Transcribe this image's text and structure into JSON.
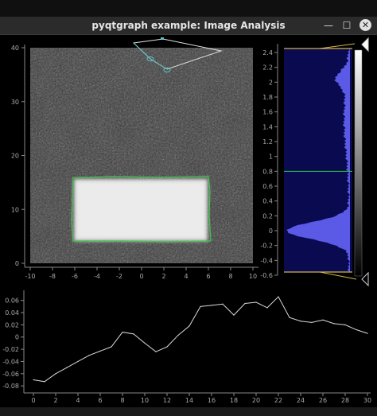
{
  "window": {
    "title": "pyqtgraph example: Image Analysis",
    "buttons": {
      "minimize": "—",
      "maximize": "☐",
      "close": "✕"
    }
  },
  "image_view": {
    "x_ticks": [
      "-10",
      "-8",
      "-6",
      "-4",
      "-2",
      "0",
      "2",
      "4",
      "6",
      "8",
      "10"
    ],
    "y_ticks": [
      "0",
      "10",
      "20",
      "30",
      "40"
    ]
  },
  "histogram": {
    "ticks": [
      "2.4",
      "2.2",
      "2",
      "1.8",
      "1.6",
      "1.4",
      "1.2",
      "1",
      "0.8",
      "0.6",
      "0.4",
      "0.2",
      "0",
      "-0.2",
      "-0.4",
      "-0.6"
    ],
    "level_line": 0.8,
    "colors": {
      "background": "#0a0a50",
      "fill": "#5a5ae6",
      "level": "#2ecc40",
      "region": "#d4b44a"
    }
  },
  "chart_data": {
    "type": "line",
    "x": [
      0,
      1,
      2,
      3,
      4,
      5,
      6,
      7,
      8,
      9,
      10,
      11,
      12,
      13,
      14,
      15,
      16,
      17,
      18,
      19,
      20,
      21,
      22,
      23,
      24,
      25,
      26,
      27,
      28,
      29
    ],
    "values": [
      -0.07,
      -0.073,
      -0.06,
      -0.05,
      -0.04,
      -0.03,
      -0.023,
      -0.016,
      0.008,
      0.005,
      -0.01,
      -0.024,
      -0.016,
      0.003,
      0.018,
      0.05,
      0.052,
      0.054,
      0.036,
      0.055,
      0.057,
      0.048,
      0.066,
      0.032,
      0.026,
      0.024,
      0.028,
      0.022,
      0.02,
      0.012,
      0.006
    ],
    "xlim": [
      -1,
      30
    ],
    "ylim": [
      -0.085,
      0.07
    ],
    "x_ticks": [
      "0",
      "2",
      "4",
      "6",
      "8",
      "10",
      "12",
      "14",
      "16",
      "18",
      "20",
      "22",
      "24",
      "26",
      "28",
      "30"
    ],
    "y_ticks": [
      "0.06",
      "0.04",
      "0.02",
      "0",
      "-0.02",
      "-0.04",
      "-0.06",
      "-0.08"
    ],
    "grid": false,
    "color": "#d8d8d8"
  }
}
